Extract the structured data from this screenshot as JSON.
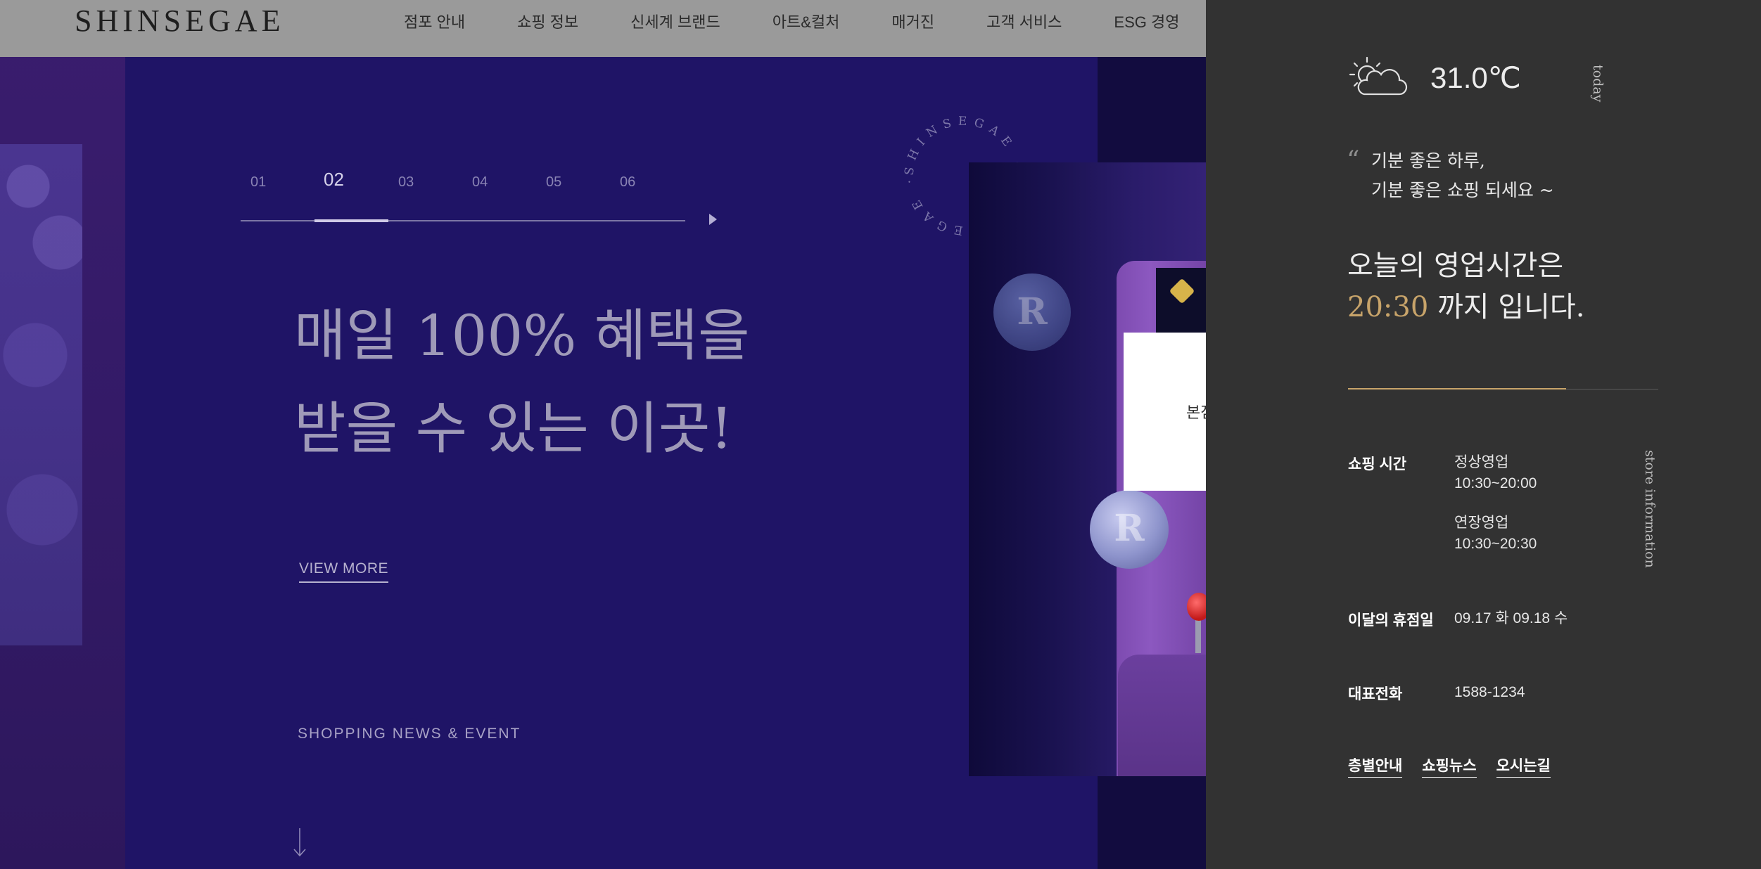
{
  "header": {
    "logo": "SHINSEGAE",
    "nav": [
      "점포 안내",
      "쇼핑 정보",
      "신세계 브랜드",
      "아트&컬처",
      "매거진",
      "고객 서비스",
      "ESG 경영"
    ]
  },
  "slider": {
    "pages": [
      "01",
      "02",
      "03",
      "04",
      "05",
      "06"
    ],
    "active_page": "02",
    "progress": 0.333
  },
  "hero": {
    "title_line1": "매일 100% 혜택을",
    "title_line2": "받을 수 있는 이곳!",
    "cta": "VIEW MORE",
    "section_label": "SHOPPING NEWS & EVENT"
  },
  "badge_text": "SHINSEGAE · SHINSEGAE · ",
  "product_image": {
    "coin_letter": "R"
  },
  "store_select": {
    "value": "본점"
  },
  "info": {
    "temperature": "31.0℃",
    "today_label": "today",
    "greeting_line1": "기분 좋은 하루,",
    "greeting_line2": "기분 좋은 쇼핑 되세요 ~",
    "hours_line1": "오늘의 영업시간은",
    "closing_time": "20:30",
    "hours_line2_suffix": "까지 입니다.",
    "side_label": "store information",
    "shopping_hours_label": "쇼핑 시간",
    "regular_label": "정상영업",
    "regular_hours": "10:30~20:00",
    "extended_label": "연장영업",
    "extended_hours": "10:30~20:30",
    "holiday_label": "이달의 휴점일",
    "holiday_value": "09.17 화 09.18 수",
    "phone_label": "대표전화",
    "phone_value": "1588-1234",
    "links": [
      "층별안내",
      "쇼핑뉴스",
      "오시는길"
    ]
  },
  "colors": {
    "accent_gold": "#c8a46a",
    "panel_bg": "#323232",
    "hero_bg": "#1f1466",
    "caret_red": "#d8282a"
  }
}
